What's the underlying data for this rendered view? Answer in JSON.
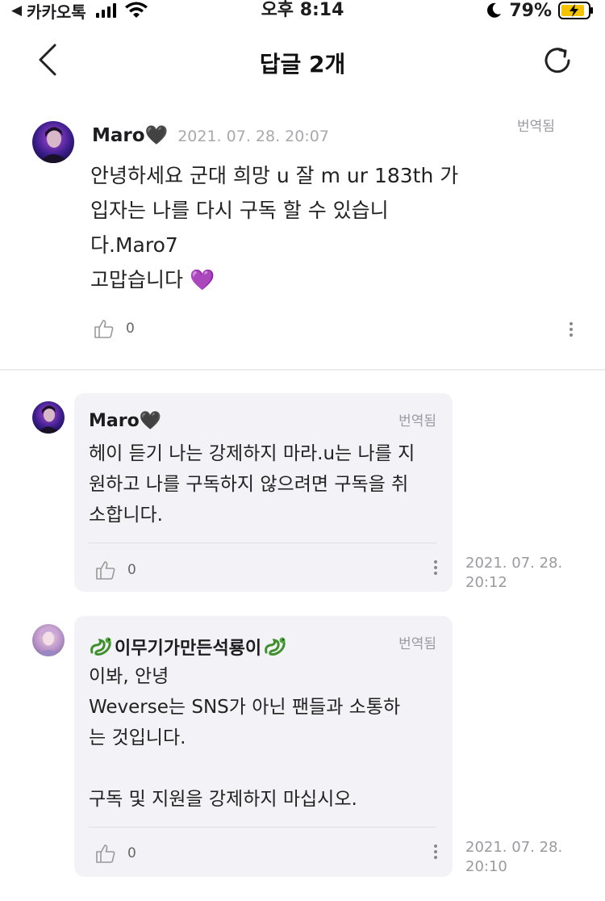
{
  "status_bar": {
    "carrier": "카카오톡",
    "time": "오후 8:14",
    "battery": "79%"
  },
  "header": {
    "title": "답글 2개"
  },
  "main_comment": {
    "author": "Maro🖤",
    "timestamp": "2021. 07. 28. 20:07",
    "translated_label": "번역됨",
    "body": " 안녕하세요 군대 희망 u 잘 m ur 183th 가\n입자는 나를 다시 구독 할 수 있습니\n다.Maro7\n고맙습니다 💜",
    "likes": "0"
  },
  "replies": [
    {
      "author": "Maro🖤",
      "translated_label": "번역됨",
      "body": "헤이 듣기 나는 강제하지 마라.u는 나를 지\n원하고 나를 구독하지 않으려면 구독을 취\n소합니다.",
      "likes": "0",
      "timestamp": "2021. 07. 28.\n20:12"
    },
    {
      "author": "이무기가만든석룡이",
      "translated_label": "번역됨",
      "body": "이봐, 안녕\nWeverse는 SNS가 아닌 팬들과 소통하\n는 것입니다.\n\n구독 및 지원을 강제하지 마십시오.",
      "likes": "0",
      "timestamp": "2021. 07. 28.\n20:10"
    }
  ],
  "colors": {
    "bubble_bg": "#f3f3f7",
    "muted_text": "#9a9aa0",
    "divider": "#ececef"
  },
  "icons": [
    "back-arrow-icon",
    "refresh-icon",
    "thumbs-up-icon",
    "more-vertical-icon",
    "dragon-emoji-icon",
    "wifi-icon",
    "moon-icon",
    "battery-charging-icon"
  ]
}
